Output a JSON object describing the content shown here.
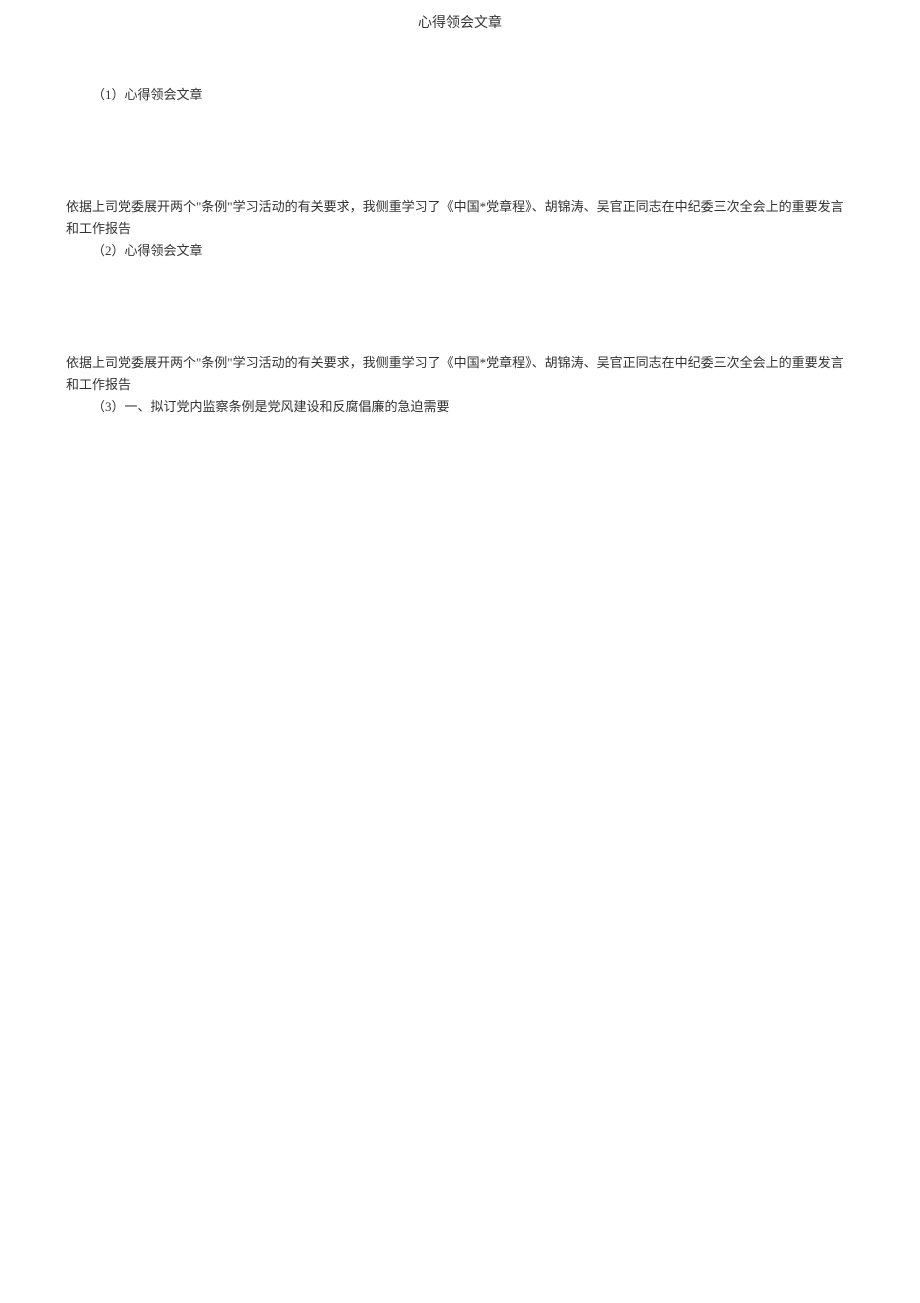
{
  "title": "心得领会文章",
  "sections": [
    {
      "heading": "（1）心得领会文章",
      "paragraph": "依据上司党委展开两个\"条例\"学习活动的有关要求，我侧重学习了《中国*党章程》、胡锦涛、吴官正同志在中纪委三次全会上的重要发言和工作报告"
    },
    {
      "heading": "（2）心得领会文章",
      "paragraph": "依据上司党委展开两个\"条例\"学习活动的有关要求，我侧重学习了《中国*党章程》、胡锦涛、吴官正同志在中纪委三次全会上的重要发言和工作报告"
    },
    {
      "heading": "（3）一、拟订党内监察条例是党风建设和反腐倡廉的急迫需要",
      "paragraph": ""
    }
  ]
}
